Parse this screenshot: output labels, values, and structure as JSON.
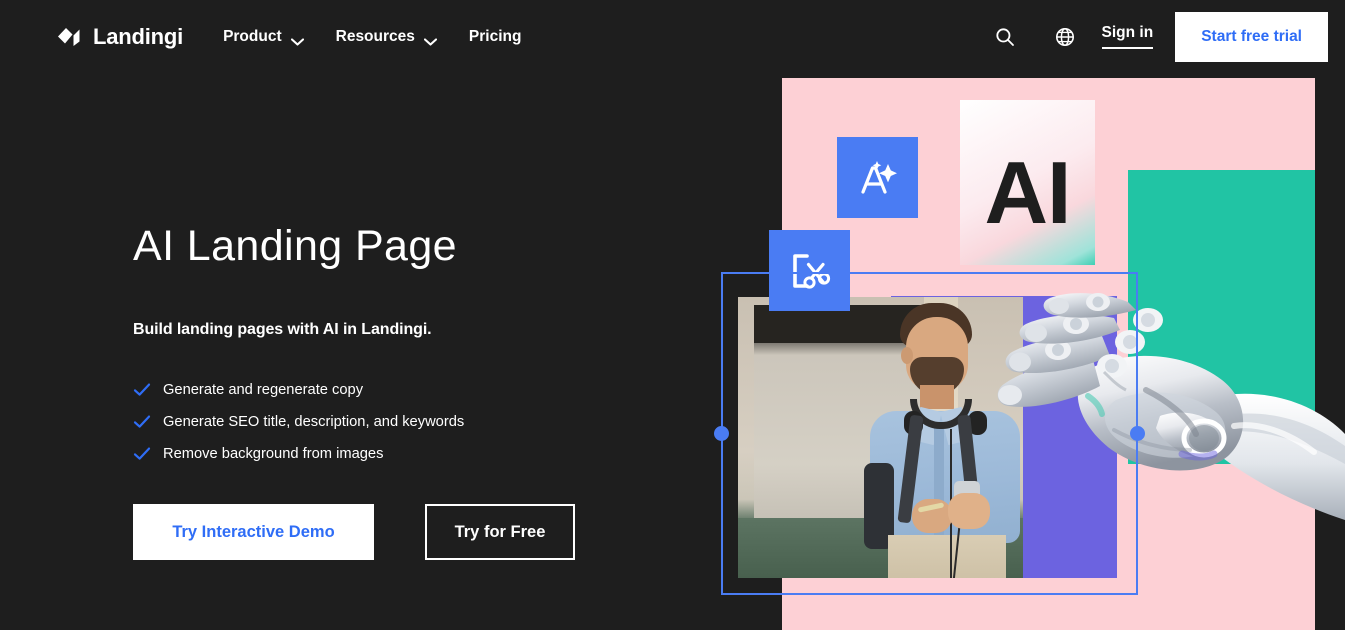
{
  "brand": {
    "name": "Landingi",
    "logo_icon": "diamond-logo-icon"
  },
  "nav": {
    "links": [
      {
        "label": "Product",
        "has_dropdown": true,
        "icon": "chevron-down-icon"
      },
      {
        "label": "Resources",
        "has_dropdown": true,
        "icon": "chevron-down-icon"
      },
      {
        "label": "Pricing",
        "has_dropdown": false,
        "icon": ""
      }
    ],
    "search_icon": "search-icon",
    "language_icon": "globe-icon",
    "sign_in_label": "Sign in",
    "trial_label": "Start free trial"
  },
  "hero": {
    "title": "AI Landing Page",
    "subtitle": "Build landing pages with AI in Landingi.",
    "features": [
      {
        "icon": "check-icon",
        "text": "Generate and regenerate copy"
      },
      {
        "icon": "check-icon",
        "text": "Generate SEO title, description, and keywords"
      },
      {
        "icon": "check-icon",
        "text": "Remove background from images"
      }
    ],
    "primary_cta": "Try Interactive Demo",
    "secondary_cta": "Try for Free"
  },
  "artwork": {
    "ai_card_text": "AI",
    "magic_chip_icon": "ai-text-magic-icon",
    "cut_chip_icon": "remove-background-scissors-icon",
    "selection_frame": "image-selection-frame",
    "handles": [
      "resize-handle-left",
      "resize-handle-right"
    ],
    "photo_subject": "man-with-backpack-and-phone-photo",
    "robot_hand": "robot-hand-image"
  },
  "colors": {
    "background": "#1e1e1e",
    "accent_blue": "#2f6df6",
    "chip_blue": "#4a7cf3",
    "pink": "#fdd0d5",
    "teal": "#21c4a4",
    "purple": "#6c63e0",
    "white": "#ffffff"
  }
}
